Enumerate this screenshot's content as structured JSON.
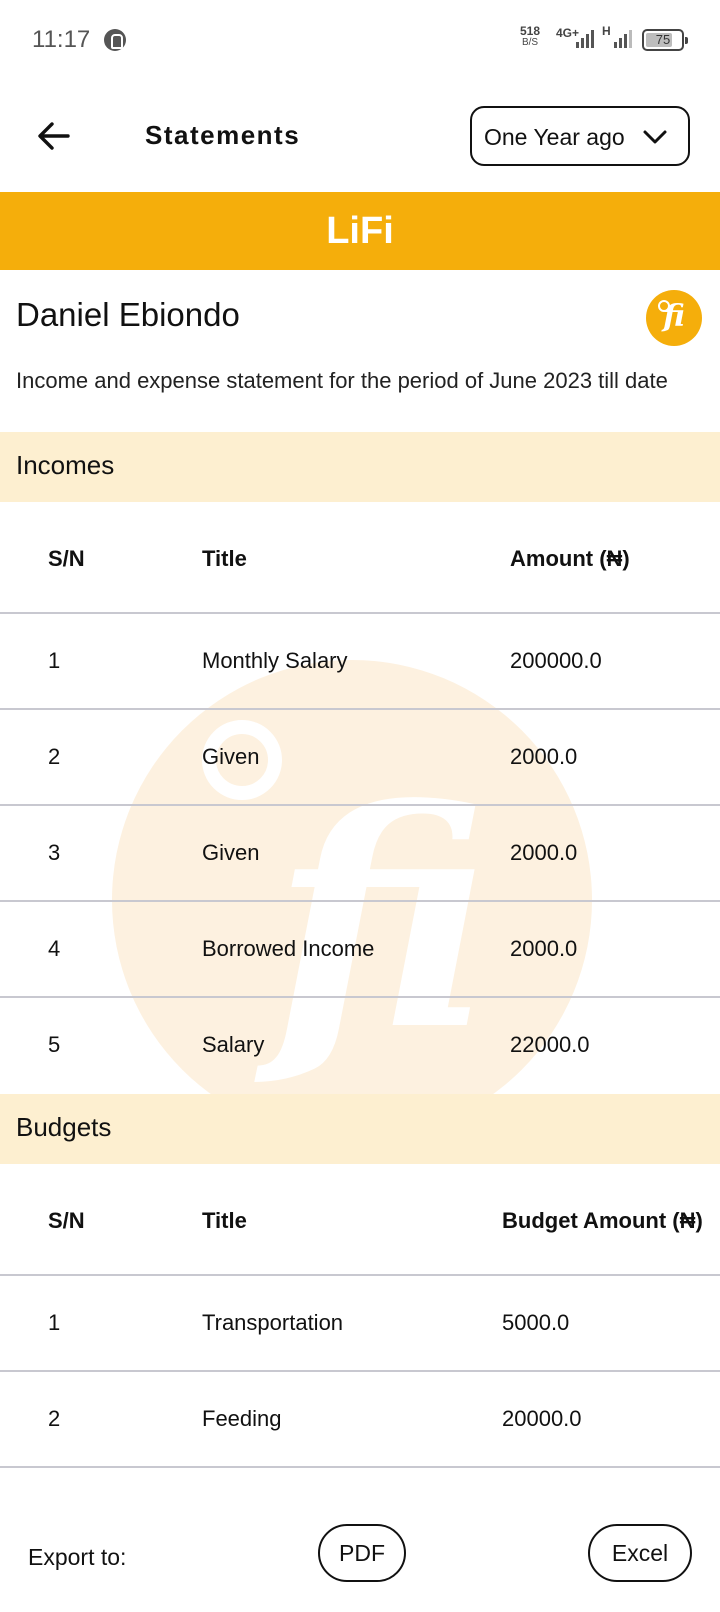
{
  "status_bar": {
    "time": "11:17",
    "net_speed_value": "518",
    "net_speed_unit": "B/S",
    "network": "4G+",
    "network2": "H",
    "battery": "75",
    "battery_level": 0.75
  },
  "header": {
    "title": "Statements",
    "period_selected": "One Year ago"
  },
  "brand": {
    "name": "LiFi",
    "logo_text": "fi",
    "accent_color": "#f5ae0b"
  },
  "user": {
    "name": "Daniel Ebiondo",
    "description": "Income and expense statement for the period of June 2023 till date"
  },
  "incomes": {
    "section_title": "Incomes",
    "columns": [
      "S/N",
      "Title",
      "Amount (₦)"
    ],
    "rows": [
      {
        "sn": "1",
        "title": "Monthly Salary",
        "amount": "200000.0"
      },
      {
        "sn": "2",
        "title": "Given",
        "amount": "2000.0"
      },
      {
        "sn": "3",
        "title": "Given",
        "amount": "2000.0"
      },
      {
        "sn": "4",
        "title": "Borrowed Income",
        "amount": "2000.0"
      },
      {
        "sn": "5",
        "title": "Salary",
        "amount": "22000.0"
      }
    ]
  },
  "budgets": {
    "section_title": "Budgets",
    "columns": [
      "S/N",
      "Title",
      "Budget Amount (₦)"
    ],
    "rows": [
      {
        "sn": "1",
        "title": "Transportation",
        "amount": "5000.0"
      },
      {
        "sn": "2",
        "title": "Feeding",
        "amount": "20000.0"
      }
    ]
  },
  "export": {
    "label": "Export to:",
    "pdf": "PDF",
    "excel": "Excel"
  }
}
